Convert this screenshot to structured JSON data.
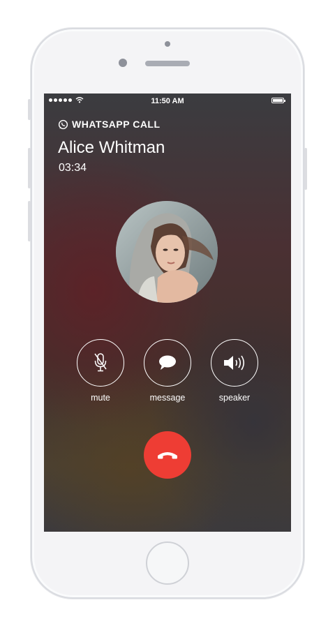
{
  "status_bar": {
    "time": "11:50 AM"
  },
  "call": {
    "type_label": "WHATSAPP CALL",
    "contact_name": "Alice Whitman",
    "duration": "03:34"
  },
  "actions": {
    "mute_label": "mute",
    "message_label": "message",
    "speaker_label": "speaker"
  },
  "icons": {
    "whatsapp": "whatsapp-icon",
    "mute": "mic-off-icon",
    "message": "speech-bubble-icon",
    "speaker": "speaker-volume-icon",
    "end_call": "phone-hangup-icon"
  },
  "colors": {
    "end_call": "#ee3d34",
    "text": "#ffffff"
  }
}
